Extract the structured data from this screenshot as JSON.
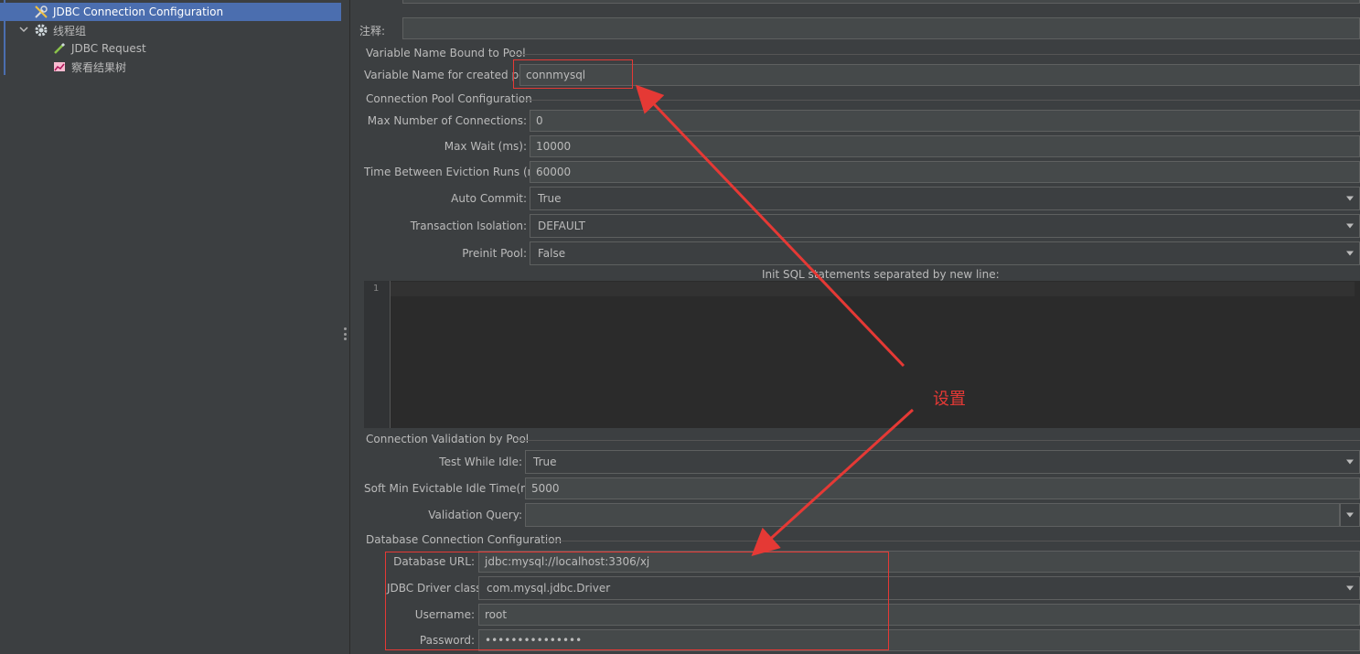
{
  "tree": {
    "items": [
      {
        "label": "JDBC Connection Configuration",
        "icon": "wrench-screwdriver-icon"
      },
      {
        "label": "线程组",
        "icon": "gear-icon"
      },
      {
        "label": "JDBC Request",
        "icon": "pipette-icon"
      },
      {
        "label": "察看结果树",
        "icon": "chart-icon"
      }
    ]
  },
  "header": {
    "comment_label": "注释:",
    "comment_value": ""
  },
  "variable_pool": {
    "section_title": "Variable Name Bound to Pool",
    "var_label": "Variable Name for created pool:",
    "var_value": "connmysql"
  },
  "pool_config": {
    "section_title": "Connection Pool Configuration",
    "max_connections_label": "Max Number of Connections:",
    "max_connections_value": "0",
    "max_wait_label": "Max Wait (ms):",
    "max_wait_value": "10000",
    "eviction_label": "Time Between Eviction Runs (ms):",
    "eviction_value": "60000",
    "auto_commit_label": "Auto Commit:",
    "auto_commit_value": "True",
    "isolation_label": "Transaction Isolation:",
    "isolation_value": "DEFAULT",
    "preinit_label": "Preinit Pool:",
    "preinit_value": "False",
    "init_sql_label": "Init SQL statements separated by new line:",
    "line_number": "1"
  },
  "validation": {
    "section_title": "Connection Validation by Pool",
    "test_idle_label": "Test While Idle:",
    "test_idle_value": "True",
    "soft_min_label": "Soft Min Evictable Idle Time(ms):",
    "soft_min_value": "5000",
    "query_label": "Validation Query:",
    "query_value": ""
  },
  "database": {
    "section_title": "Database Connection Configuration",
    "url_label": "Database URL:",
    "url_value": "jdbc:mysql://localhost:3306/xj",
    "driver_label": "JDBC Driver class:",
    "driver_value": "com.mysql.jdbc.Driver",
    "username_label": "Username:",
    "username_value": "root",
    "password_label": "Password:",
    "password_value": "•••••••••••••••"
  },
  "annotation": {
    "text": "设置",
    "color": "#e53935"
  }
}
